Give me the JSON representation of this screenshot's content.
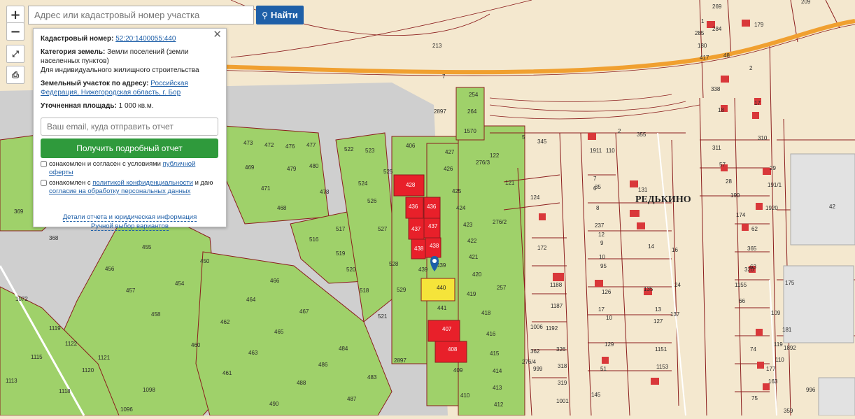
{
  "search": {
    "placeholder": "Адрес или кадастровый номер участка",
    "button_label": "Найти"
  },
  "toolbar": {
    "zoom_in": "+",
    "zoom_out": "−"
  },
  "popup": {
    "cadastral_label": "Кадастровый номер:",
    "cadastral_number": "52:20:1400055:440",
    "category_label": "Категория земель:",
    "category_value": "Земли поселений (земли населенных пунктов)",
    "usage": "Для индивидуального жилищного строительства",
    "address_label": "Земельный участок по адресу:",
    "address_value": "Российская Федерация, Нижегородская область, г. Бор",
    "area_label": "Уточненная площадь:",
    "area_value": "1 000 кв.м.",
    "email_placeholder": "Ваш email, куда отправить отчет",
    "get_report_label": "Получить подробный отчет",
    "consent1_prefix": "ознакомлен и согласен с условиями",
    "consent1_link": "публичной оферты",
    "consent2_prefix": "ознакомлен с",
    "consent2_link1": "политикой конфиденциальности",
    "consent2_mid": "и даю",
    "consent2_link2": "согласие на обработку персональных данных",
    "details_link": "Детали отчета и юридическая информация",
    "manual_link": "Ручной выбор вариантов"
  },
  "map": {
    "settlement": "РЕДЬКИНО",
    "road_number": "7",
    "selected_parcel": "440",
    "colors": {
      "background": "#f4e8cf",
      "parcel_green": "#9fd16a",
      "parcel_red": "#e8202a",
      "selected": "#f5e43a",
      "road": "#c8c8c8",
      "highway": "#f0a030",
      "boundary": "#8b1d1d",
      "marker": "#1e5fa8"
    },
    "labels": [
      "269",
      "209",
      "1",
      "179",
      "285",
      "284",
      "180",
      "417",
      "213",
      "48",
      "2",
      "338",
      "18",
      "17",
      "254",
      "2897",
      "264",
      "1570",
      "5",
      "345",
      "1911",
      "110",
      "2",
      "355",
      "406",
      "427",
      "122",
      "121",
      "7",
      "6",
      "131",
      "311",
      "57",
      "28",
      "310",
      "29",
      "191/1",
      "1920",
      "42",
      "369",
      "473",
      "472",
      "476",
      "477",
      "469",
      "479",
      "480",
      "471",
      "478",
      "468",
      "522",
      "523",
      "524",
      "525",
      "526",
      "428",
      "426",
      "436",
      "436",
      "425",
      "424",
      "437",
      "437",
      "423",
      "438",
      "438",
      "422",
      "439",
      "439",
      "421",
      "440",
      "420",
      "419",
      "257",
      "441",
      "418",
      "407",
      "416",
      "408",
      "415",
      "409",
      "414",
      "413",
      "412",
      "410",
      "455",
      "456",
      "457",
      "454",
      "450",
      "458",
      "466",
      "464",
      "467",
      "462",
      "465",
      "460",
      "463",
      "461",
      "484",
      "486",
      "483",
      "488",
      "487",
      "490",
      "1098",
      "1096",
      "1113",
      "1118",
      "1115",
      "1119",
      "1122",
      "1121",
      "1120",
      "1072",
      "368",
      "516",
      "517",
      "519",
      "520",
      "518",
      "521",
      "527",
      "528",
      "529",
      "2897",
      "124",
      "172",
      "1188",
      "1187",
      "1192",
      "326",
      "318",
      "319",
      "1001",
      "1006",
      "362",
      "999",
      "276/3",
      "276/2",
      "276/4",
      "237",
      "12",
      "9",
      "95",
      "126",
      "10",
      "129",
      "51",
      "145",
      "135",
      "127",
      "1151",
      "1153",
      "190",
      "174",
      "62",
      "365",
      "63",
      "320",
      "1155",
      "175",
      "66",
      "181",
      "1892",
      "74",
      "75",
      "109",
      "119",
      "110",
      "163",
      "35",
      "8",
      "10",
      "14",
      "13",
      "17",
      "16",
      "24",
      "137",
      "996",
      "359",
      "177",
      "Редькино"
    ]
  }
}
